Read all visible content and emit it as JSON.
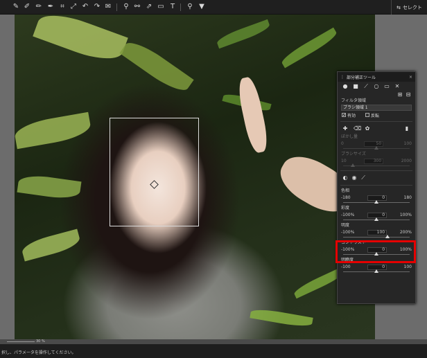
{
  "toolbar": {
    "right_label": "セレクト"
  },
  "panel": {
    "title": "部分補正ツール",
    "filter_area_label": "フィルタ領域",
    "filter_area_value": "ブラシ領域 1",
    "enabled_label": "有効",
    "enabled_checked": true,
    "invert_label": "反転",
    "invert_checked": false,
    "blur_label": "ぼかし量",
    "blur": {
      "min": "0",
      "value": "50",
      "max": "100",
      "level": 0.5
    },
    "brush_size_label": "ブラシサイズ",
    "brush_size": {
      "min": "10",
      "value": "300",
      "max": "2000",
      "level": 0.15
    },
    "adjustments": [
      {
        "label": "色相",
        "min": "-180",
        "value": "0",
        "max": "180",
        "level": 0.5,
        "dim": false
      },
      {
        "label": "彩度",
        "min": "-100%",
        "value": "0",
        "max": "100%",
        "level": 0.5,
        "dim": false
      },
      {
        "label": "明度",
        "min": "-100%",
        "value": "100",
        "max": "200%",
        "level": 0.67,
        "dim": false
      },
      {
        "label": "コントラスト",
        "min": "-100%",
        "value": "0",
        "max": "100%",
        "level": 0.5,
        "dim": false
      },
      {
        "label": "明瞭度",
        "min": "-100",
        "value": "0",
        "max": "100",
        "level": 0.5,
        "dim": false
      }
    ]
  },
  "zoom": {
    "value": "30 %"
  },
  "status": {
    "text": "択し、パラメータを操作してください。"
  }
}
